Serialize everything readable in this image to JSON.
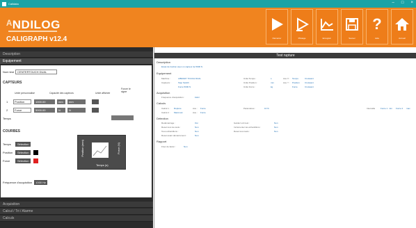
{
  "window": {
    "title": "Calidata",
    "controls": [
      "–",
      "□",
      "×"
    ]
  },
  "logo": {
    "brand_a": "ᴬ",
    "brand_b": "NDILOG",
    "product": "CALIGRAPH v12.4"
  },
  "toolbar": [
    {
      "label": "Démarrer",
      "icon": "play-icon"
    },
    {
      "label": "Pilotage",
      "icon": "step-play-icon"
    },
    {
      "label": "Enregistr.",
      "icon": "chart-icon"
    },
    {
      "label": "Sauver",
      "icon": "save-icon"
    },
    {
      "label": "Aide",
      "icon": "help-icon"
    },
    {
      "label": "Accueil",
      "icon": "home-icon"
    }
  ],
  "left": {
    "sections": [
      "Description",
      "Equipement",
      "Acquisition",
      "Calcul / Tri / Alarme",
      "Calculs"
    ],
    "name_label": "Nom test",
    "name_value": "CENTERTOUCH DUAL",
    "capteurs_title": "CAPTEURS",
    "capteurs_headers": [
      "Unité personnalisé",
      "Capacité des capteurs",
      "Unité affichée",
      "Forcer le signe"
    ],
    "capteurs": [
      {
        "num": "1",
        "name": "Position",
        "cap": "1000.00",
        "unit": "mm",
        "shown": "mm"
      },
      {
        "num": "2",
        "name": "Force",
        "cap": "5000.00",
        "unit": "N",
        "shown": "N"
      }
    ],
    "poids_label": "Temps",
    "courbes_title": "COURBES",
    "courbes": [
      {
        "label": "Temps",
        "button": "Sélection",
        "color": ""
      },
      {
        "label": "Position",
        "button": "Sélection",
        "color": "#000000"
      },
      {
        "label": "Force",
        "button": "Sélection",
        "color": "#e02020"
      }
    ],
    "chart_box": {
      "left": "Position (mm)",
      "right": "Force (N)",
      "bottom": "Temps (s)"
    },
    "freq_label": "Fréquence d'acquisition",
    "freq_value": "1000 Hz"
  },
  "right": {
    "title": "Test rupture",
    "description": {
      "title": "Description",
      "text": "Essai de traction avec un capteur de 5000 N"
    },
    "equipement": {
      "title": "Equipement",
      "line1": [
        "Machine :",
        "LIBRARY TOUCH DUAL",
        "Unité Temps :",
        "s",
        "Axe X :",
        "Temps",
        "Croissant"
      ],
      "line2": [
        "Capteurs :",
        "Step Switch",
        "Unité Position :",
        "mm",
        "Axe Y :",
        "Position",
        "Croissant"
      ],
      "line3": [
        "",
        "Force 5000 N",
        "Unité Force :",
        "kg",
        "",
        "Force",
        "Croissant"
      ]
    },
    "acquisition": {
      "title": "Acquisition",
      "text": "Fréquence d'acquisition :",
      "value": "1kHz"
    },
    "calculs": {
      "title": "Calculs",
      "line1": [
        "Calcul 1 :",
        "Rupture",
        "Axe :",
        "Force",
        "Paramètres :",
        "10 %",
        "Intervalle",
        "Force 1",
        "min",
        "Force 2",
        "max"
      ],
      "line2": [
        "Calcul 2 :",
        "Maximum",
        "Axe :",
        "Force"
      ]
    },
    "detection": {
      "title": "Détection",
      "rows": [
        [
          "Redémarrage :",
          "Oui",
          "Gardez unit test :",
          "Non"
        ],
        [
          "Reset tous les tests :",
          "Non",
          "Incrémenter les échantillons :",
          "Non"
        ],
        [
          "Tous échantillons :",
          "Non",
          "Reset tous tests :",
          "Non"
        ],
        [
          "Reset avant démarrement :",
          "Non",
          "",
          ""
        ]
      ]
    },
    "rapport": {
      "title": "Rapport",
      "text": "Fixer de factor :",
      "value": "Non"
    }
  }
}
